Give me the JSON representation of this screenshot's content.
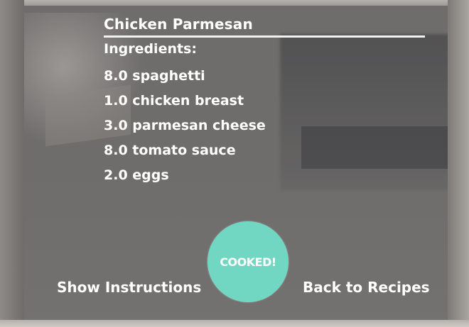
{
  "recipe": {
    "title": "Chicken Parmesan",
    "ingredients_heading": "Ingredients:",
    "ingredients": [
      "8.0 spaghetti",
      "1.0 chicken breast",
      "3.0 parmesan cheese",
      "8.0 tomato sauce",
      "2.0 eggs"
    ]
  },
  "actions": {
    "show_instructions_label": "Show Instructions",
    "cooked_label": "COOKED!",
    "back_label": "Back to Recipes"
  },
  "colors": {
    "accent": "#72d7c2",
    "text": "#ffffff"
  }
}
